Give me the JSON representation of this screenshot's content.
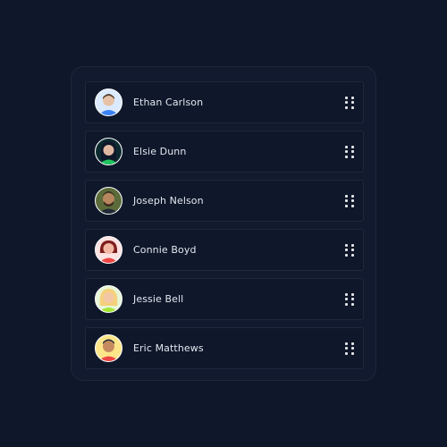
{
  "list": {
    "items": [
      {
        "name": "Ethan Carlson",
        "avatar": {
          "skin": "#e7c2a7",
          "hair": "#5a4636",
          "shirt": "#3b82f6",
          "bg": "#dbeafe"
        },
        "handle_icon": "drag-handle-icon"
      },
      {
        "name": "Elsie Dunn",
        "avatar": {
          "skin": "#e0b8a1",
          "hair": "#0f172a",
          "shirt": "#22c55e",
          "bg": "#0b2a2f"
        },
        "handle_icon": "drag-handle-icon"
      },
      {
        "name": "Joseph Nelson",
        "avatar": {
          "skin": "#b8865f",
          "hair": "#3a2a1e",
          "shirt": "#1f2937",
          "bg": "#5b6b3a"
        },
        "handle_icon": "drag-handle-icon"
      },
      {
        "name": "Connie Boyd",
        "avatar": {
          "skin": "#f2b8a3",
          "hair": "#7f1d1d",
          "shirt": "#ef4444",
          "bg": "#fde2e2"
        },
        "handle_icon": "drag-handle-icon"
      },
      {
        "name": "Jessie Bell",
        "avatar": {
          "skin": "#f2c7a5",
          "hair": "#f5d07b",
          "shirt": "#a3e635",
          "bg": "#e6f6d6"
        },
        "handle_icon": "drag-handle-icon"
      },
      {
        "name": "Eric Matthews",
        "avatar": {
          "skin": "#c58b5f",
          "hair": "#1f2937",
          "shirt": "#ef4444",
          "bg": "#fde68a"
        },
        "handle_icon": "drag-handle-icon"
      }
    ]
  },
  "colors": {
    "background": "#0f172a",
    "panel": "#111a2f",
    "border": "#1e293b",
    "text": "#e2e8f0",
    "handle": "#e5e7eb"
  }
}
